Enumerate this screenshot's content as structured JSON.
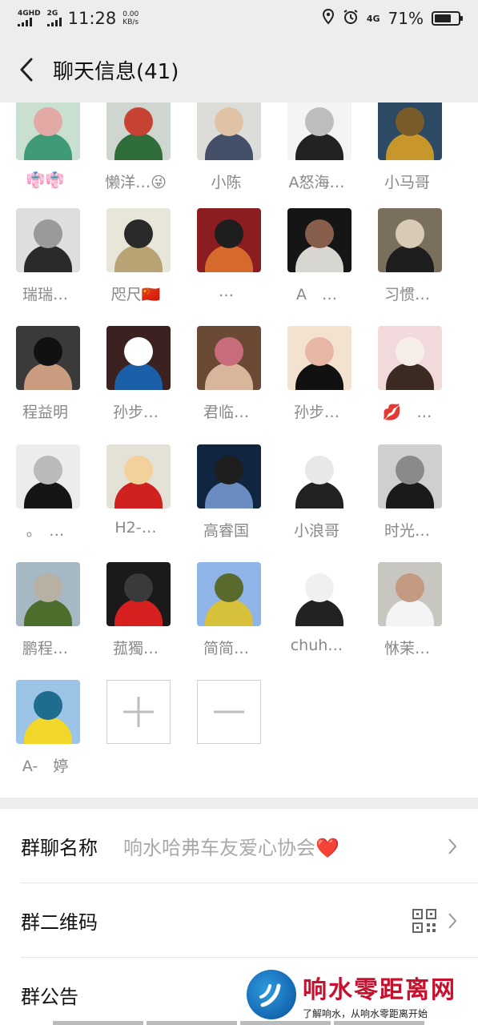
{
  "status": {
    "sim1": "4GHD",
    "sim2": "2G",
    "time": "11:28",
    "speed_value": "0.00",
    "speed_unit": "KB/s",
    "net": "4G",
    "battery": "71%",
    "battery_level": 0.71
  },
  "header": {
    "title": "聊天信息(41)"
  },
  "members": [
    {
      "name": "👘👘",
      "colors": [
        "#c9dfd0",
        "#3e9a77",
        "#e3a9a4"
      ]
    },
    {
      "name": "懒洋…😜",
      "colors": [
        "#cfd5cf",
        "#2f6d3a",
        "#c64334"
      ]
    },
    {
      "name": "小陈",
      "colors": [
        "#dcdcd8",
        "#445068",
        "#e0c3a6"
      ]
    },
    {
      "name": "A怒海…",
      "colors": [
        "#f4f4f4",
        "#222222",
        "#bdbdbd"
      ]
    },
    {
      "name": "小马哥",
      "colors": [
        "#2c4a63",
        "#c8972c",
        "#7a5c2a"
      ]
    },
    {
      "name": "瑞瑞…",
      "colors": [
        "#dedede",
        "#2a2a2a",
        "#9a9a9a"
      ]
    },
    {
      "name": "咫尺🇨🇳",
      "colors": [
        "#e8e6d8",
        "#b9a274",
        "#2a2a2a"
      ]
    },
    {
      "name": "…",
      "colors": [
        "#8b1c1f",
        "#d66a2c",
        "#1e1e1e"
      ]
    },
    {
      "name": "A　…",
      "colors": [
        "#151515",
        "#d8d6d0",
        "#875d4c"
      ]
    },
    {
      "name": "习惯…",
      "colors": [
        "#7a6e5d",
        "#1e1e1e",
        "#d8cbb6"
      ]
    },
    {
      "name": "程益明",
      "colors": [
        "#3a3a3a",
        "#c99b7f",
        "#111111"
      ]
    },
    {
      "name": "孙步…",
      "colors": [
        "#3b2120",
        "#1a5fa8",
        "#ffffff"
      ]
    },
    {
      "name": "君临…",
      "colors": [
        "#6b4a35",
        "#d9b59c",
        "#c86c7c"
      ]
    },
    {
      "name": "孙步…",
      "colors": [
        "#f3e2cf",
        "#111111",
        "#e7b7a5"
      ]
    },
    {
      "name": "💋　…",
      "colors": [
        "#f1d9dc",
        "#3a2a22",
        "#f7ede8"
      ]
    },
    {
      "name": "。　…",
      "colors": [
        "#ececec",
        "#151515",
        "#bababa"
      ]
    },
    {
      "name": "H2-…",
      "colors": [
        "#e4e1d6",
        "#d02020",
        "#f2d19c"
      ]
    },
    {
      "name": "高睿国",
      "colors": [
        "#10253f",
        "#6a8cc1",
        "#1e1e1e"
      ]
    },
    {
      "name": "小浪哥",
      "colors": [
        "#ffffff",
        "#222222",
        "#e8e8e8"
      ]
    },
    {
      "name": "时光…",
      "colors": [
        "#cfcfcf",
        "#1a1a1a",
        "#8a8a8a"
      ]
    },
    {
      "name": "鹏程…",
      "colors": [
        "#a6b8c4",
        "#4d6d2d",
        "#b9b0a4"
      ]
    },
    {
      "name": "菰獨…",
      "colors": [
        "#1a1a1a",
        "#d62020",
        "#3a3a3a"
      ]
    },
    {
      "name": "简简…",
      "colors": [
        "#8fb4e8",
        "#d8c13a",
        "#5a6a2c"
      ]
    },
    {
      "name": "chuh…",
      "colors": [
        "#ffffff",
        "#222222",
        "#f0f0f0"
      ]
    },
    {
      "name": "恘茉…",
      "colors": [
        "#c8c6c0",
        "#f4f4f4",
        "#c49a82"
      ]
    },
    {
      "name": "A-　婷",
      "colors": [
        "#9bc4e6",
        "#f2d62a",
        "#1f6d8e"
      ]
    }
  ],
  "actions": {
    "add": "+",
    "remove": "−"
  },
  "settings": {
    "group_name_label": "群聊名称",
    "group_name_value": "响水哈弗车友爱心协会❤️",
    "qr_label": "群二维码",
    "notice_label": "群公告"
  },
  "watermark": {
    "title": "响水零距离网",
    "subtitle": "了解响水，从响水零距离开始"
  },
  "colors": {
    "background": "#ededed",
    "panel": "#ffffff",
    "member_name": "#888888",
    "watermark_red": "#c8102e"
  }
}
